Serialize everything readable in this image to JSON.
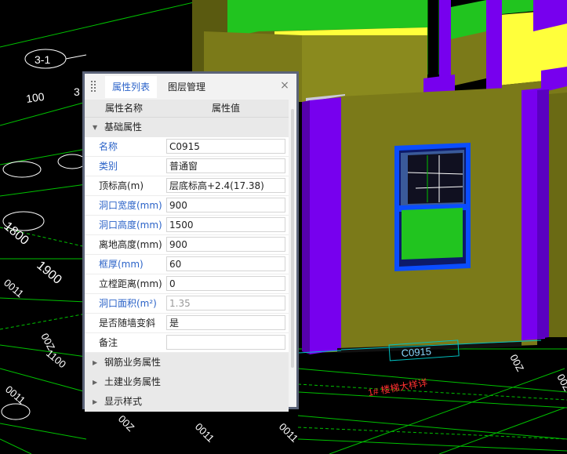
{
  "colors": {
    "background": "#000000",
    "grid_line": "#00d000",
    "cad_text": "#ffffff",
    "wall_olive": "#7b7a19",
    "wall_olive_dark": "#5e5e12",
    "yellow": "#ffff3b",
    "green": "#21c41f",
    "purple": "#7700ee",
    "window_frame_blue": "#0a4dff",
    "red_text": "#ff3030",
    "panel_bg": "#f2f2f2",
    "accent_blue": "#2b63c8"
  },
  "cad": {
    "axis_bubble": "3-1",
    "dim_100": "100",
    "dim_3": "3",
    "dim_1800": "1800",
    "dim_1900": "1900",
    "window_tag": "C0915",
    "mirror_labels": [
      "0011",
      "1100",
      "0011",
      "0011",
      "00Z",
      "00Z"
    ],
    "red_note": "1# 楼梯大样详"
  },
  "panel": {
    "tabs": [
      {
        "label": "属性列表"
      },
      {
        "label": "图层管理"
      }
    ],
    "close_icon": "×",
    "header": {
      "name": "属性名称",
      "value": "属性值"
    },
    "groups": [
      {
        "label": "基础属性",
        "expanded": true
      },
      {
        "label": "钢筋业务属性",
        "expanded": false
      },
      {
        "label": "土建业务属性",
        "expanded": false
      },
      {
        "label": "显示样式",
        "expanded": false
      }
    ],
    "rows": [
      {
        "name": "名称",
        "value": "C0915",
        "blue": true,
        "gray": false
      },
      {
        "name": "类别",
        "value": "普通窗",
        "blue": true,
        "gray": false
      },
      {
        "name": "顶标高(m)",
        "value": "层底标高+2.4(17.38)",
        "blue": false,
        "gray": false
      },
      {
        "name": "洞口宽度(mm)",
        "value": "900",
        "blue": true,
        "gray": false
      },
      {
        "name": "洞口高度(mm)",
        "value": "1500",
        "blue": true,
        "gray": false
      },
      {
        "name": "离地高度(mm)",
        "value": "900",
        "blue": false,
        "gray": false
      },
      {
        "name": "框厚(mm)",
        "value": "60",
        "blue": true,
        "gray": false
      },
      {
        "name": "立樘距离(mm)",
        "value": "0",
        "blue": false,
        "gray": false
      },
      {
        "name": "洞口面积(m²)",
        "value": "1.35",
        "blue": true,
        "gray": true
      },
      {
        "name": "是否随墙变斜",
        "value": "是",
        "blue": false,
        "gray": false
      },
      {
        "name": "备注",
        "value": "",
        "blue": false,
        "gray": false
      }
    ]
  }
}
